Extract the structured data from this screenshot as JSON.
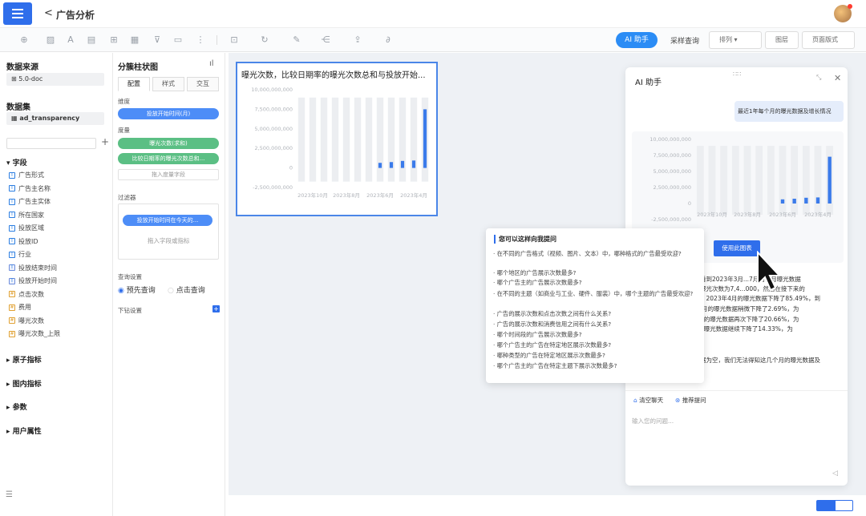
{
  "header": {
    "back": "<",
    "title": "广告分析"
  },
  "toolbar": {
    "ai": "AI 助手",
    "sample": "采样查询",
    "sort": "排列",
    "layer": "图层",
    "page_format": "页面版式"
  },
  "left": {
    "datasource_title": "数据来源",
    "datasource_value": "5.0-doc",
    "dataset_title": "数据集",
    "dataset_value": "ad_transparency",
    "fields_title": "字段",
    "fields": [
      "广告形式",
      "广告主名称",
      "广告主实体",
      "所在国家",
      "投放区域",
      "投放ID",
      "行业",
      "投放结束时间",
      "投放开始时间",
      "点击次数",
      "费用",
      "曝光次数",
      "曝光次数_上限"
    ],
    "groups": [
      "原子指标",
      "图内指标",
      "参数",
      "用户属性"
    ]
  },
  "mid": {
    "chart_type": "分簇柱状图",
    "tabs": [
      "配置",
      "样式",
      "交互"
    ],
    "dimension_label": "维度",
    "dimension_pill": "投放开始时间(月)",
    "measure_label": "度量",
    "measure_pills": [
      "曝光次数(求和)",
      "比较日期率的曝光次数总和..."
    ],
    "measure_drop": "拖入度量字段",
    "filter_label": "过滤器",
    "filter_pill": "投放开始时间在今天的...",
    "filter_drop": "拖入字段或指标",
    "query_label": "查询设置",
    "query_options": [
      "预先查询",
      "点击查询"
    ],
    "drill_label": "下钻设置"
  },
  "chart_data": [
    {
      "type": "bar",
      "title": "曝光次数，比较日期率的曝光次数总和与投放开始...",
      "yticks": [
        "10,000,000,000",
        "7,500,000,000",
        "5,000,000,000",
        "2,500,000,000",
        "0",
        "-2,500,000,000"
      ],
      "xticks": [
        "2023年10月",
        "2023年8月",
        "2023年6月",
        "2023年4月"
      ],
      "ylim": [
        -2500000000,
        10000000000
      ],
      "values": [
        0,
        0,
        0,
        0,
        0,
        0,
        0,
        650000000,
        750000000,
        900000000,
        950000000,
        7500000000
      ]
    },
    {
      "type": "bar",
      "yticks": [
        "10,000,000,000",
        "7,500,000,000",
        "5,000,000,000",
        "2,500,000,000",
        "0",
        "-2,500,000,000"
      ],
      "xticks": [
        "2023年10月",
        "2023年8月",
        "2023年6月",
        "2023年4月"
      ],
      "ylim": [
        -2500000000,
        10000000000
      ],
      "values": [
        0,
        0,
        0,
        0,
        0,
        0,
        0,
        650000000,
        750000000,
        900000000,
        950000000,
        7300000000
      ]
    }
  ],
  "ai": {
    "title": "AI 助手",
    "user_msg": "最近1年每个月的曝光数据及增长情况",
    "use_chart": "使用此图表",
    "answer_lines": [
      "可以看到2023年3月...7月的每月曝光数据",
      "月的曝光次数为7,4...000，然后在接下来的",
      "下降。2023年4月的曝光数据下降了85.49%，到",
      "3年5月的曝光数据稍微下降了2.69%，为",
      "年6月的曝光数据再次下降了20.66%，为",
      "7月的曝光数据继续下降了14.33%，为",
      "，数据为空，我们无法得知这几个月的曝光数据及"
    ],
    "clear": "清空聊天",
    "recommend": "推荐提问",
    "input_placeholder": "输入您的问题..."
  },
  "popup": {
    "title": "您可以这样向我提问",
    "questions": [
      "在不同的广告格式（视频、图片、文本）中，哪种格式的广告最受欢迎?",
      "哪个地区的广告展示次数最多?",
      "哪个广告主的广告展示次数最多?",
      "在不同的主题（如商业与工业、硬件、服装）中，哪个主题的广告最受欢迎?",
      "广告的展示次数和点击次数之间有什么关系?",
      "广告的展示次数和消费信用之间有什么关系?",
      "哪个时间段的广告展示次数最多?",
      "哪个广告主的广告在特定地区展示次数最多?",
      "哪种类型的广告在特定地区展示次数最多?",
      "哪个广告主的广告在特定主题下展示次数最多?"
    ]
  },
  "colors": {
    "accent": "#2f6eeb",
    "bar": "#3b7bea",
    "pill_green": "#5bbf84"
  }
}
